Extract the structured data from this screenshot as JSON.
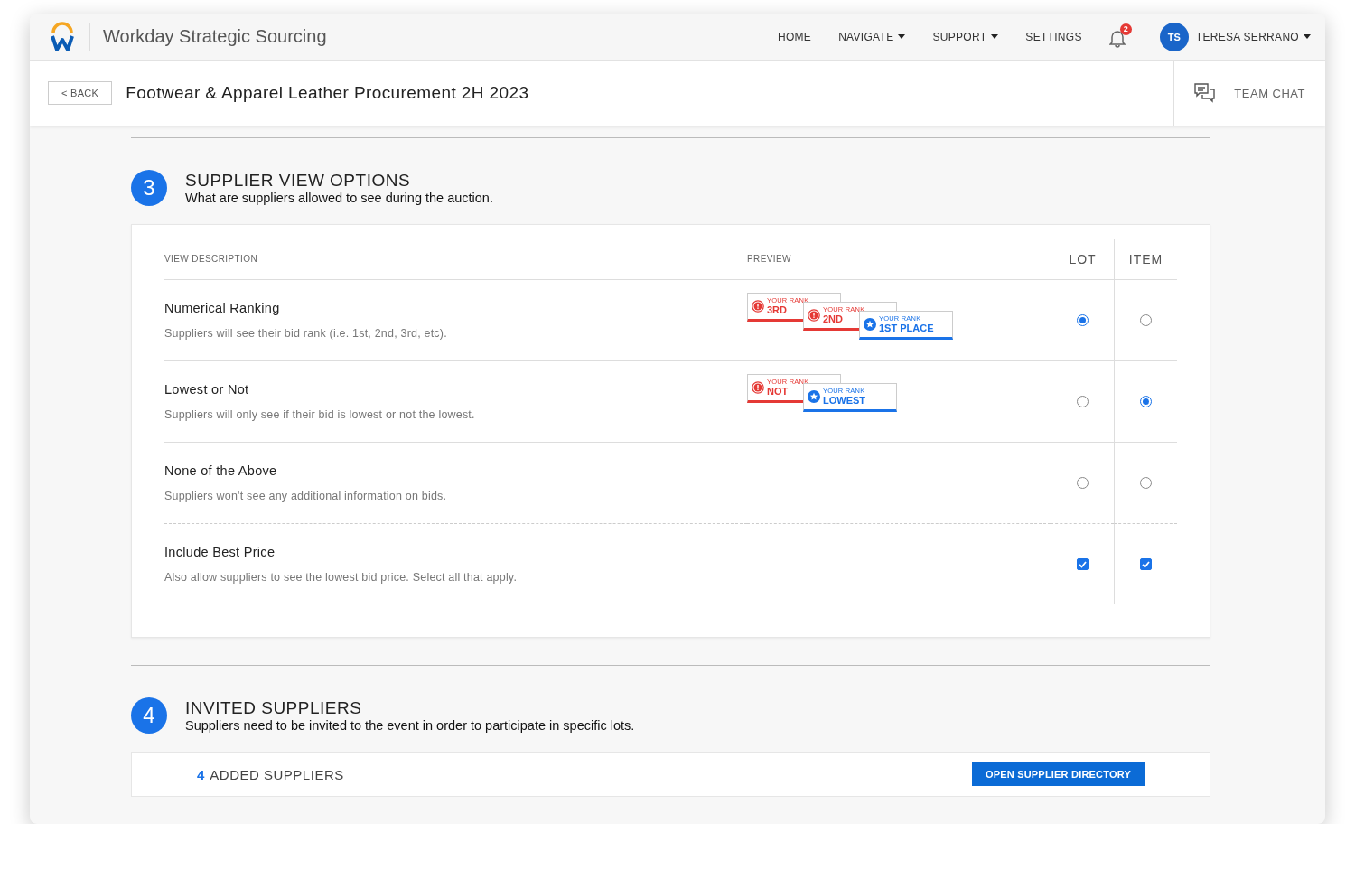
{
  "app": {
    "name": "Workday Strategic Sourcing"
  },
  "nav": [
    {
      "label": "HOME",
      "dropdown": false
    },
    {
      "label": "NAVIGATE",
      "dropdown": true
    },
    {
      "label": "SUPPORT",
      "dropdown": true
    },
    {
      "label": "SETTINGS",
      "dropdown": false
    }
  ],
  "notifications": {
    "count": "2"
  },
  "user": {
    "initials": "TS",
    "name": "TERESA SERRANO"
  },
  "page": {
    "back": "< BACK",
    "title": "Footwear & Apparel Leather Procurement 2H 2023",
    "team_chat": "TEAM CHAT"
  },
  "sections": [
    {
      "number": "3",
      "title": "SUPPLIER VIEW OPTIONS",
      "subtitle": "What are suppliers allowed to see during the auction.",
      "kind": "view_options",
      "columns": [
        "VIEW DESCRIPTION",
        "PREVIEW",
        "LOT",
        "ITEM"
      ],
      "rows": [
        {
          "kind": "radio",
          "title": "Numerical Ranking",
          "description": "Suppliers will see their bid rank (i.e. 1st, 2nd, 3rd, etc).",
          "preview": [
            {
              "kind": "alert",
              "caption": "YOUR RANK",
              "value": "3RD"
            },
            {
              "kind": "alert",
              "caption": "YOUR RANK",
              "value": "2ND"
            },
            {
              "kind": "star",
              "caption": "YOUR RANK",
              "value": "1ST PLACE"
            }
          ],
          "lot": {
            "selected": true
          },
          "item": {
            "selected": false
          }
        },
        {
          "kind": "radio",
          "title": "Lowest or Not",
          "description": "Suppliers will only see if their bid is lowest or not the lowest.",
          "preview": [
            {
              "kind": "alert",
              "caption": "YOUR RANK",
              "value": "NOT"
            },
            {
              "kind": "star",
              "caption": "YOUR RANK",
              "value": "LOWEST"
            }
          ],
          "lot": {
            "selected": false
          },
          "item": {
            "selected": true
          }
        },
        {
          "kind": "radio",
          "title": "None of the Above",
          "description": "Suppliers won't see any additional information on bids.",
          "preview": [],
          "lot": {
            "selected": false
          },
          "item": {
            "selected": false
          }
        },
        {
          "kind": "checkbox",
          "title": "Include Best Price",
          "description": "Also allow suppliers to see the lowest bid price. Select all that apply.",
          "preview": [],
          "lot": {
            "checked": true
          },
          "item": {
            "checked": true
          }
        }
      ]
    },
    {
      "number": "4",
      "title": "INVITED SUPPLIERS",
      "subtitle": "Suppliers need to be invited to the event in order to participate in specific lots.",
      "kind": "suppliers",
      "count": "4",
      "count_label": "ADDED SUPPLIERS",
      "button": "OPEN SUPPLIER DIRECTORY"
    }
  ]
}
